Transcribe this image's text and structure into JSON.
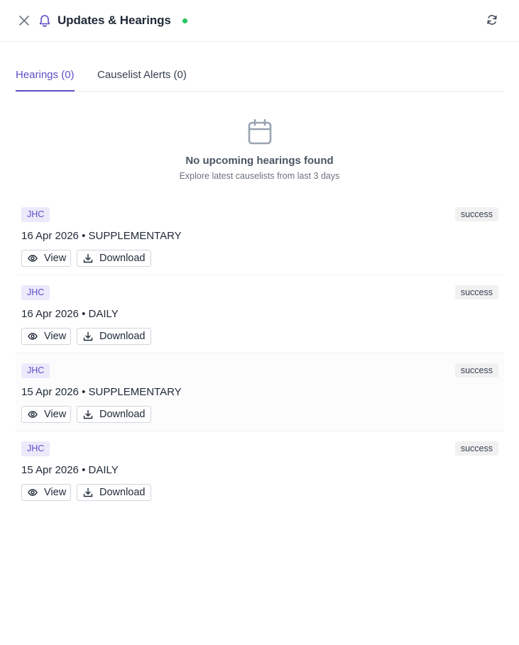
{
  "header": {
    "title": "Updates & Hearings",
    "status_dot_color": "#22c55e",
    "icons": [
      "close-icon",
      "bell-icon",
      "refresh-icon"
    ]
  },
  "tabs": [
    {
      "label": "Hearings (0)",
      "active": true
    },
    {
      "label": "Causelist Alerts (0)",
      "active": false
    }
  ],
  "empty_state": {
    "icon": "calendar-icon",
    "title": "No upcoming hearings found",
    "subtitle": "Explore latest causelists from last 3 days"
  },
  "causelists": [
    {
      "court": "JHC",
      "status": "success",
      "date": "16 Apr 2026",
      "type": "SUPPLEMENTARY",
      "view_label": "View",
      "download_label": "Download"
    },
    {
      "court": "JHC",
      "status": "success",
      "date": "16 Apr 2026",
      "type": "DAILY",
      "view_label": "View",
      "download_label": "Download"
    },
    {
      "court": "JHC",
      "status": "success",
      "date": "15 Apr 2026",
      "type": "SUPPLEMENTARY",
      "view_label": "View",
      "download_label": "Download"
    },
    {
      "court": "JHC",
      "status": "success",
      "date": "15 Apr 2026",
      "type": "DAILY",
      "view_label": "View",
      "download_label": "Download"
    }
  ],
  "colors": {
    "accent": "#5b4fc7",
    "badge_bg": "#ece9fb",
    "status_bg": "#f1f1f1"
  }
}
